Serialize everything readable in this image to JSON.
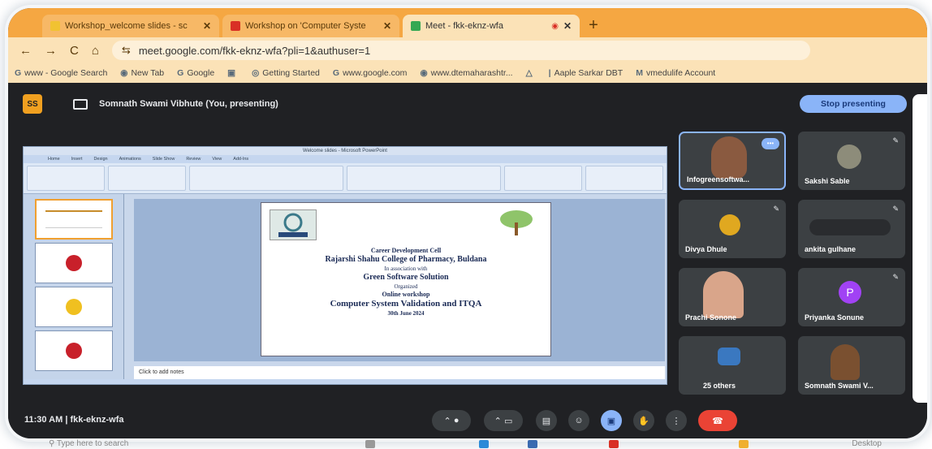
{
  "browser": {
    "tabs": [
      {
        "title": "Workshop_welcome slides - sc",
        "icon": "slides-icon",
        "color": "#f1c232",
        "active": false
      },
      {
        "title": "Workshop on 'Computer Syste",
        "icon": "gmail-icon",
        "color": "#d93025",
        "active": false
      },
      {
        "title": "Meet - fkk-eknz-wfa",
        "icon": "meet-icon",
        "color": "#34a853",
        "active": true
      }
    ],
    "tab_close": "✕",
    "new_tab": "+",
    "nav": {
      "back": "←",
      "forward": "→",
      "reload": "C",
      "home": "⌂"
    },
    "url": "meet.google.com/fkk-eknz-wfa?pli=1&authuser=1",
    "url_prefix": "⇆",
    "bookmarks": [
      {
        "icon": "G",
        "label": "www - Google Search"
      },
      {
        "icon": "◉",
        "label": "New Tab"
      },
      {
        "icon": "G",
        "label": "Google"
      },
      {
        "icon": "▣",
        "label": ""
      },
      {
        "icon": "◎",
        "label": "Getting Started"
      },
      {
        "icon": "G",
        "label": "www.google.com"
      },
      {
        "icon": "◉",
        "label": "www.dtemaharashtr..."
      },
      {
        "icon": "△",
        "label": ""
      },
      {
        "icon": "|",
        "label": "Aaple Sarkar DBT"
      },
      {
        "icon": "M",
        "label": "vmedulife Account"
      }
    ]
  },
  "meet": {
    "avatar_initials": "SS",
    "presenter": "Somnath Swami Vibhute (You, presenting)",
    "stop_label": "Stop presenting",
    "meeting_time": "11:30 AM",
    "meeting_code": "fkk-eknz-wfa",
    "participants": [
      {
        "name": "Infogreensoftwa...",
        "type": "video"
      },
      {
        "name": "Sakshi Sable",
        "type": "photo"
      },
      {
        "name": "Divya Dhule",
        "type": "photo"
      },
      {
        "name": "ankita gulhane",
        "type": "icons"
      },
      {
        "name": "Prachi Sonone",
        "type": "video"
      },
      {
        "name": "Priyanka Sonune",
        "type": "initial",
        "initial": "P"
      },
      {
        "name": "25 others",
        "type": "group"
      },
      {
        "name": "Somnath Swami V...",
        "type": "video"
      }
    ],
    "more_options": "•••",
    "mute_glyph": "✎"
  },
  "ppt": {
    "title": "Welcome slides - Microsoft PowerPoint",
    "ribbon_tabs": [
      "Home",
      "Insert",
      "Design",
      "Animations",
      "Slide Show",
      "Review",
      "View",
      "Add-Ins"
    ],
    "notes": "Click to add notes",
    "slide": {
      "line1": "Career Development Cell",
      "line2": "Rajarshi Shahu College of Pharmacy, Buldana",
      "line3": "In association with",
      "line4": "Green Software Solution",
      "line5": "Organized",
      "line6": "Online workshop",
      "line7": "Computer System Validation and ITQA",
      "line8": "30th June 2024"
    }
  },
  "taskbar": {
    "search_placeholder": "Type here to search",
    "desktop": "Desktop"
  },
  "colors": {
    "tab_bar": "#f5a742",
    "meet_bg": "#202124",
    "accent_blue": "#8ab4f8",
    "end_call_red": "#ea4335"
  }
}
